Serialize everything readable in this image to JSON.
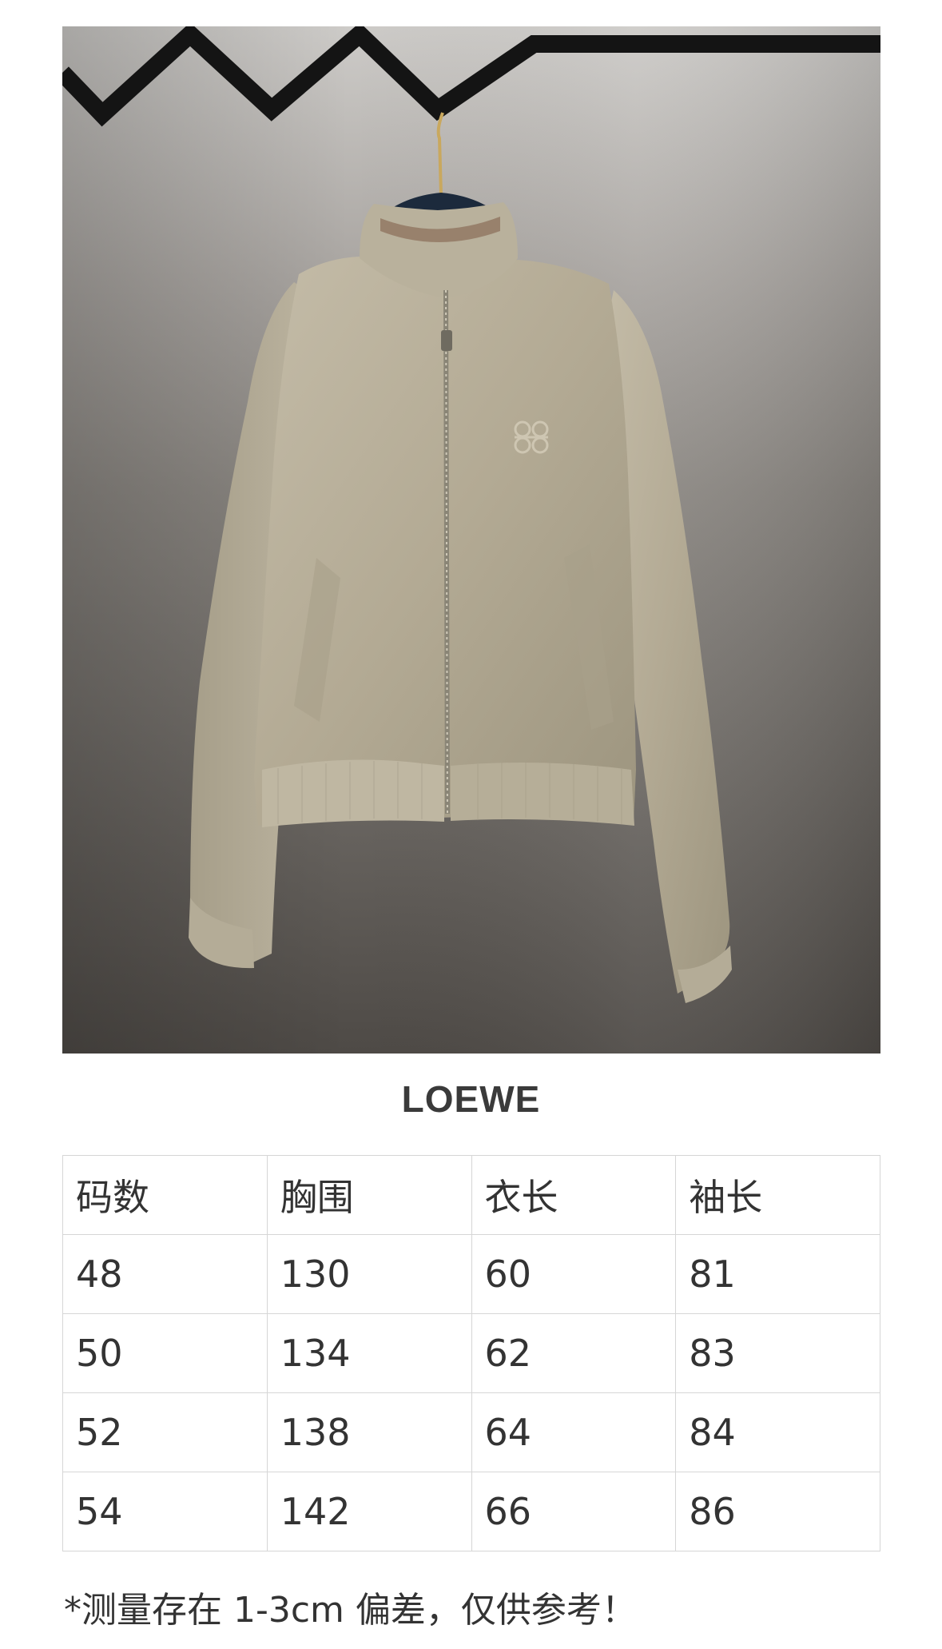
{
  "brand": "LOEWE",
  "size_table": {
    "headers": [
      "码数",
      "胸围",
      "衣长",
      "袖长"
    ],
    "rows": [
      [
        "48",
        "130",
        "60",
        "81"
      ],
      [
        "50",
        "134",
        "62",
        "83"
      ],
      [
        "52",
        "138",
        "64",
        "84"
      ],
      [
        "54",
        "142",
        "66",
        "86"
      ]
    ]
  },
  "note": "*测量存在 1-3cm 偏差，仅供参考！",
  "colors": {
    "jacket": "#b5ad98",
    "background_light": "#c9c7c4",
    "background_dark": "#54504c",
    "rail": "#141414"
  },
  "icons": {
    "logo_embroidery": "anagram-icon"
  }
}
